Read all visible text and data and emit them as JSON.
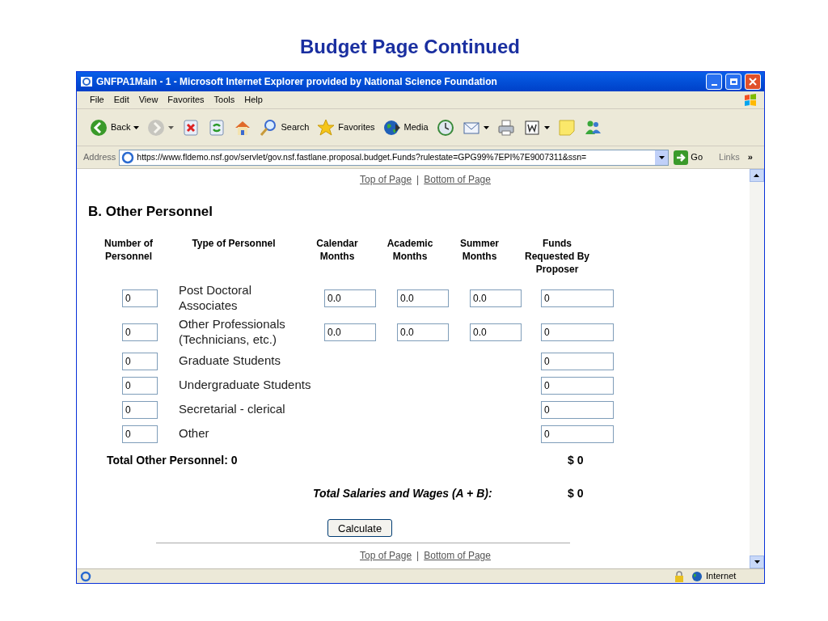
{
  "slide_title": "Budget Page Continued",
  "window": {
    "title": "GNFPA1Main - 1 - Microsoft Internet Explorer provided by National Science Foundation"
  },
  "menu": [
    "File",
    "Edit",
    "View",
    "Favorites",
    "Tools",
    "Help"
  ],
  "toolbar": [
    {
      "kind": "back",
      "label": "Back",
      "dropdown": true,
      "disabled": false
    },
    {
      "kind": "forward",
      "dropdown": true,
      "disabled": true
    },
    {
      "kind": "stop",
      "dropdown": false,
      "disabled": false
    },
    {
      "kind": "refresh",
      "dropdown": false,
      "disabled": false
    },
    {
      "kind": "home",
      "dropdown": false,
      "disabled": false
    },
    {
      "kind": "search",
      "label": "Search",
      "dropdown": false,
      "disabled": false
    },
    {
      "kind": "favorites",
      "label": "Favorites",
      "dropdown": false,
      "disabled": false
    },
    {
      "kind": "media",
      "label": "Media",
      "dropdown": false,
      "disabled": false
    },
    {
      "kind": "history",
      "dropdown": false,
      "disabled": false
    },
    {
      "kind": "mail",
      "dropdown": true,
      "disabled": false
    },
    {
      "kind": "print",
      "dropdown": false,
      "disabled": false
    },
    {
      "kind": "edit",
      "dropdown": true,
      "disabled": false
    },
    {
      "kind": "note",
      "dropdown": false,
      "disabled": false
    },
    {
      "kind": "messenger",
      "dropdown": false,
      "disabled": false
    }
  ],
  "address_bar": {
    "label": "Address",
    "url": "https://www.fldemo.nsf.gov/servlet/gov.nsf.fastlane.proposal.budget.Funds?rulestate=GPG99%7EPI%7E9007311&ssn=",
    "go": "Go",
    "links": "Links",
    "more": "»"
  },
  "nav_top": {
    "top": "Top of Page",
    "separator": "|",
    "bottom": "Bottom of Page"
  },
  "section_title": "B. Other Personnel",
  "columns": [
    "Number of Personnel",
    "Type of Personnel",
    "Calendar Months",
    "Academic Months",
    "Summer Months",
    "Funds Requested By Proposer"
  ],
  "rows": [
    {
      "number": "0",
      "type": "Post Doctoral Associates",
      "calendar": "0.0",
      "academic": "0.0",
      "summer": "0.0",
      "funds": "0"
    },
    {
      "number": "0",
      "type": "Other Professionals (Technicians, etc.)",
      "calendar": "0.0",
      "academic": "0.0",
      "summer": "0.0",
      "funds": "0"
    },
    {
      "number": "0",
      "type": "Graduate Students",
      "funds": "0"
    },
    {
      "number": "0",
      "type": "Undergraduate Students",
      "funds": "0"
    },
    {
      "number": "0",
      "type": "Secretarial - clerical",
      "funds": "0"
    },
    {
      "number": "0",
      "type": "Other",
      "funds": "0"
    }
  ],
  "total_other": {
    "label": "Total Other Personnel: 0",
    "amount": "$ 0"
  },
  "total_salaries": {
    "label": "Total Salaries and Wages (A + B):",
    "amount": "$ 0"
  },
  "calculate_button": "Calculate",
  "nav_bottom": {
    "top": "Top of Page",
    "separator": "|",
    "bottom": "Bottom of Page"
  },
  "status_bar": {
    "zone": "Internet"
  }
}
